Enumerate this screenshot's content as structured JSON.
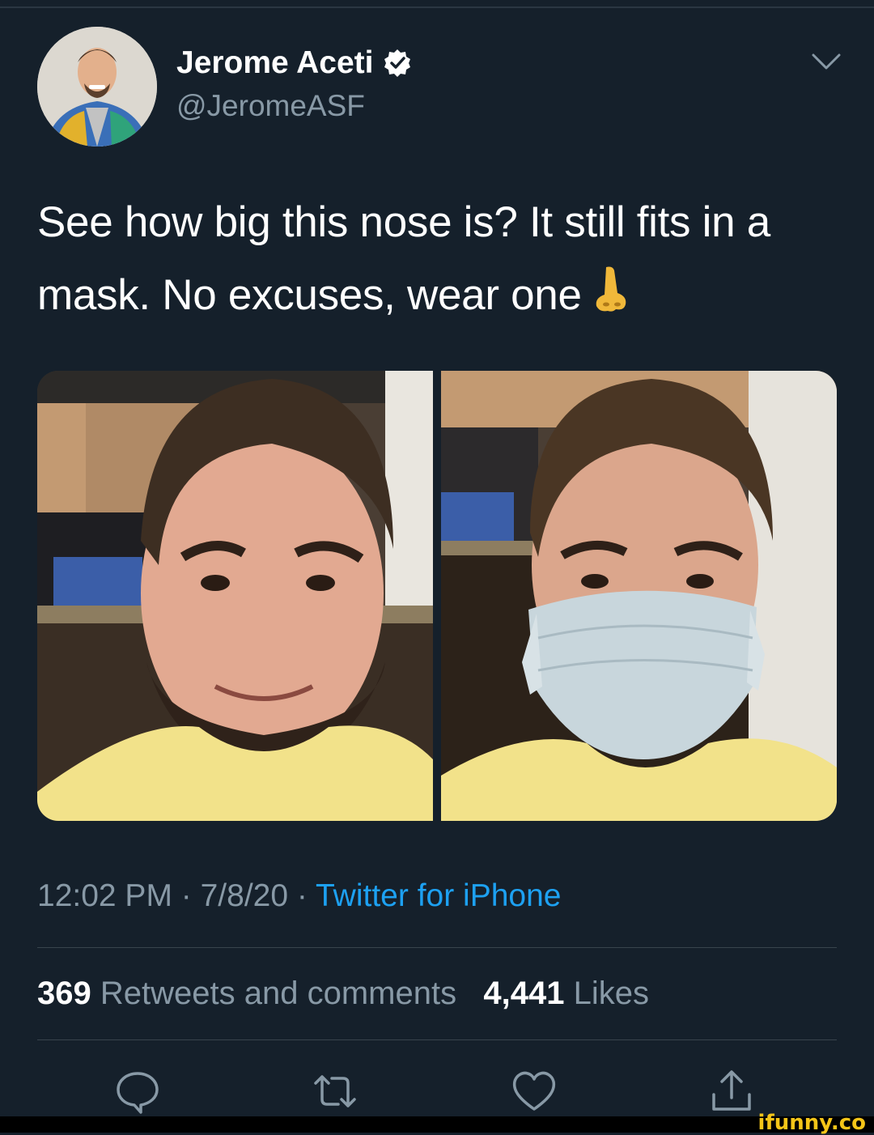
{
  "tweet": {
    "author": {
      "name": "Jerome Aceti",
      "handle": "@JeromeASF",
      "verified": true
    },
    "text": "See how big this nose is? It still fits in a mask. No excuses, wear one",
    "emoji": "nose-emoji",
    "images": [
      {
        "description": "man smiling without mask"
      },
      {
        "description": "man wearing surgical mask"
      }
    ],
    "meta": {
      "time": "12:02 PM",
      "separator1": " · ",
      "date": "7/8/20",
      "separator2": " · ",
      "source": "Twitter for iPhone"
    },
    "stats": {
      "retweets_count": "369",
      "retweets_label": "Retweets and comments",
      "likes_count": "4,441",
      "likes_label": "Likes"
    }
  },
  "actions": [
    "reply-icon",
    "retweet-icon",
    "like-icon",
    "share-icon"
  ],
  "watermark": "ifunny.co",
  "colors": {
    "background": "#15202b",
    "secondary_text": "#8899a6",
    "link": "#1da1f2",
    "divider": "#38444d"
  }
}
